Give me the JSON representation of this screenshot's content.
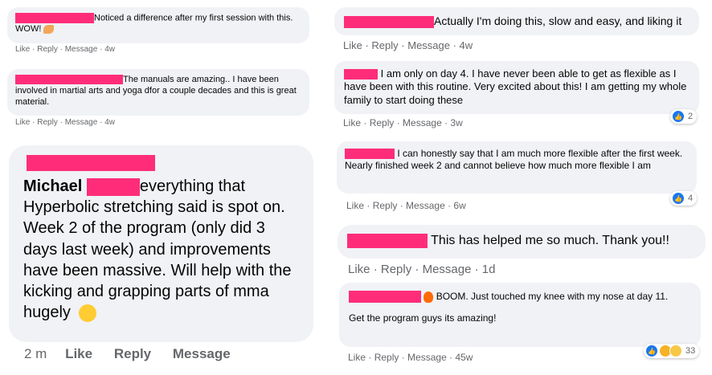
{
  "comments": [
    {
      "text": "Noticed a difference after my first session with this. WOW!",
      "actions": [
        "Like",
        "Reply",
        "Message",
        "4w"
      ]
    },
    {
      "text": "The manuals are amazing.. I have been involved in martial arts and yoga dfor a couple decades and this is great material.",
      "actions": [
        "Like",
        "Reply",
        "Message",
        "4w"
      ]
    },
    {
      "author": "Michael",
      "text": "everything that Hyperbolic stretching said is spot on. Week 2 of the program (only did 3 days last week) and improvements have been massive. Will help with the kicking and grapping parts of mma hugely",
      "actions": [
        "2 m",
        "Like",
        "Reply",
        "Message"
      ]
    },
    {
      "text": "Actually I'm doing this, slow and easy, and liking it",
      "actions": [
        "Like",
        "Reply",
        "Message",
        "4w"
      ]
    },
    {
      "text": "I am only on day 4. I have never been able to get as flexible as I have been with this routine. Very excited about this! I am getting my whole family to start doing these",
      "actions": [
        "Like",
        "Reply",
        "Message",
        "3w"
      ],
      "reactions": "2"
    },
    {
      "text": "I can honestly say that I am much more flexible after the first week. Nearly finished week 2 and cannot believe how much more flexible I am",
      "actions": [
        "Like",
        "Reply",
        "Message",
        "6w"
      ],
      "reactions": "4"
    },
    {
      "text": "This has helped me so much. Thank you!!",
      "actions": [
        "Like",
        "Reply",
        "Message",
        "1d"
      ]
    },
    {
      "text": "BOOM. Just touched my knee with my nose at day 11.",
      "text2": "Get the program guys its amazing!",
      "actions": [
        "Like",
        "Reply",
        "Message",
        "45w"
      ],
      "reactions": "33"
    }
  ],
  "colors": {
    "bubble": "#f0f2f5",
    "redaction": "#ff2d79",
    "meta": "#65676b",
    "like_blue": "#1877f2"
  },
  "icons": [
    "flexed-biceps-emoji",
    "smiling-face-emoji",
    "fire-emoji",
    "like-icon",
    "haha-icon",
    "wow-icon"
  ]
}
